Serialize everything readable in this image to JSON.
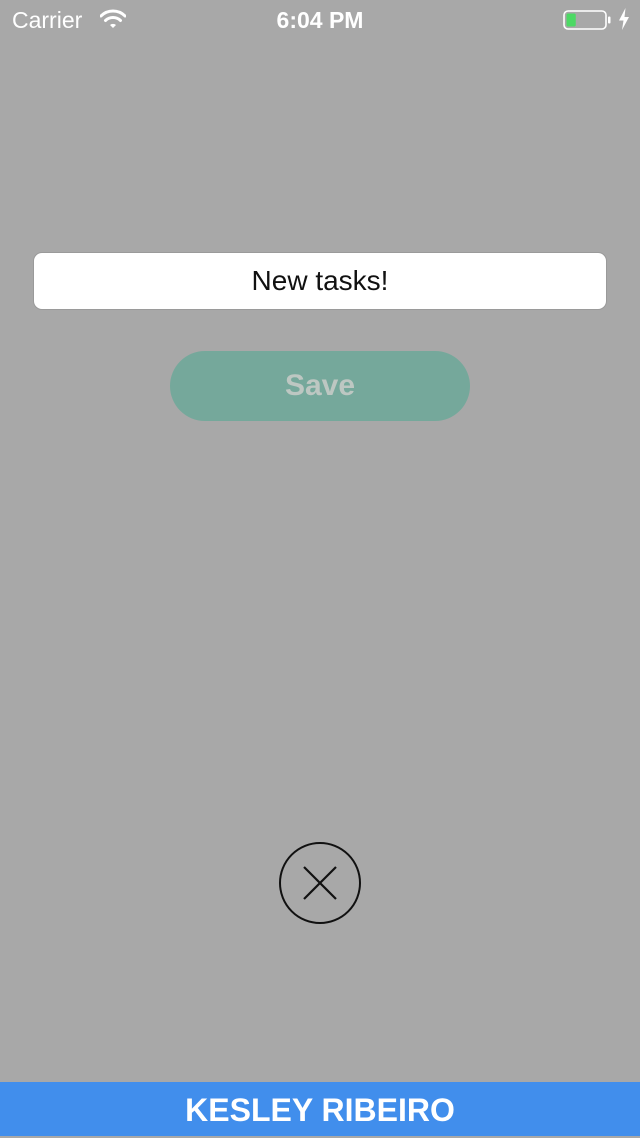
{
  "status_bar": {
    "carrier": "Carrier",
    "time": "6:04 PM",
    "wifi_icon": "wifi-icon",
    "battery_icon": "battery-charging-icon",
    "battery_level": 0.25,
    "battery_color": "#4cd964"
  },
  "form": {
    "task_value": "New tasks!",
    "save_label": "Save",
    "save_color": "#75a89b"
  },
  "close_icon": "close-circle-icon",
  "footer": {
    "author": "KESLEY RIBEIRO",
    "color": "#418eec"
  },
  "background_color": "#a8a8a8"
}
